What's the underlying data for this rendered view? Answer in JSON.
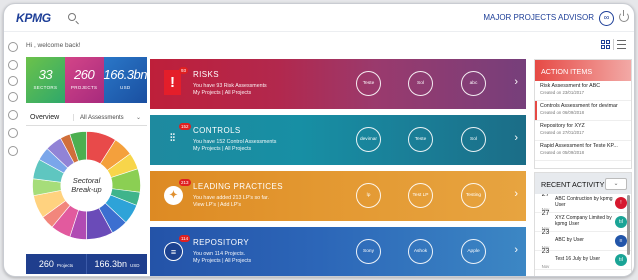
{
  "topbar": {
    "logo": "KPMG",
    "title": "MAJOR PROJECTS ADVISOR"
  },
  "welcome": "Hi , welcome back!",
  "stats": [
    {
      "value": "33",
      "label": "SECTORS"
    },
    {
      "value": "260",
      "label": "PROJECTS"
    },
    {
      "value": "166.3bn",
      "label": "USD"
    }
  ],
  "overview": {
    "title": "Overview",
    "select": "All Assessments"
  },
  "pie": {
    "label_line1": "Sectoral",
    "label_line2": "Break-up",
    "slices": [
      {
        "value": 9,
        "color": "#e84a4a"
      },
      {
        "value": 6,
        "color": "#f4a03c"
      },
      {
        "value": 5,
        "color": "#f7d54a"
      },
      {
        "value": 7,
        "color": "#8bcf53"
      },
      {
        "value": 4,
        "color": "#3fb48b"
      },
      {
        "value": 6,
        "color": "#2ea3d8"
      },
      {
        "value": 5,
        "color": "#3c6fd0"
      },
      {
        "value": 8,
        "color": "#6a4bb8"
      },
      {
        "value": 5,
        "color": "#b04bb3"
      },
      {
        "value": 6,
        "color": "#e25a9e"
      },
      {
        "value": 4,
        "color": "#f2867c"
      },
      {
        "value": 7,
        "color": "#ffd27f"
      },
      {
        "value": 5,
        "color": "#a6dd7a"
      },
      {
        "value": 6,
        "color": "#5fc6c0"
      },
      {
        "value": 4,
        "color": "#7aa6ea"
      },
      {
        "value": 5,
        "color": "#9183d6"
      },
      {
        "value": 3,
        "color": "#d06f3a"
      },
      {
        "value": 5,
        "color": "#4caf50"
      }
    ]
  },
  "bottom_stats": [
    {
      "value": "260",
      "label": "Projects"
    },
    {
      "value": "166.3bn",
      "label": "USD"
    }
  ],
  "cards": [
    {
      "key": "risks",
      "title": "RISKS",
      "count": "93",
      "icon": "exclamation-icon",
      "line1": "You have 93 Risk Assessments",
      "line2": "My Projects | All Projects",
      "circles": [
        "Teste",
        "Sol",
        "abc"
      ]
    },
    {
      "key": "controls",
      "title": "CONTROLS",
      "count": "152",
      "icon": "sliders-icon",
      "line1": "You have 152 Control Assessments",
      "line2": "My Projects | All Projects",
      "circles": [
        "devimar",
        "Teste",
        "Sol"
      ]
    },
    {
      "key": "leading",
      "title": "LEADING PRACTICES",
      "count": "213",
      "icon": "lightbulb-icon",
      "line1": "You have added 213 LP's so far.",
      "line2": "View LP's | Add LP's",
      "circles": [
        "lp",
        "Test LP",
        "Testing"
      ]
    },
    {
      "key": "repository",
      "title": "REPOSITORY",
      "count": "114",
      "icon": "database-icon",
      "line1": "You own 114 Projects.",
      "line2": "My Projects | All Projects",
      "circles": [
        "Sony",
        "Ashok",
        "Apple"
      ]
    }
  ],
  "action_items": {
    "title": "ACTION ITEMS",
    "items": [
      {
        "title": "Risk Assessment for ABC",
        "date": "Created on 23/01/2017"
      },
      {
        "title": "Controls Assessment for devimar",
        "date": "Created on 06/09/2018"
      },
      {
        "title": "Repository for XYZ",
        "date": "Created on 27/01/2017"
      },
      {
        "title": "Rapid Assessment for Teste KP...",
        "date": "Created on 05/09/2018"
      }
    ]
  },
  "recent_activity": {
    "title": "RECENT ACTIVITY",
    "items": [
      {
        "day": "27",
        "month": "Nov",
        "text": "ABC Contruction by kpmg User",
        "avatar": "!",
        "color": "red"
      },
      {
        "day": "27",
        "month": "Nov",
        "text": "XYZ Company Limited by kpmg User",
        "avatar": "tıl",
        "color": "teal"
      },
      {
        "day": "23",
        "month": "Nov",
        "text": "ABC by User",
        "avatar": "≡",
        "color": "blue"
      },
      {
        "day": "23",
        "month": "Nov",
        "text": "Test 16 July by User",
        "avatar": "tıl",
        "color": "teal"
      }
    ]
  }
}
